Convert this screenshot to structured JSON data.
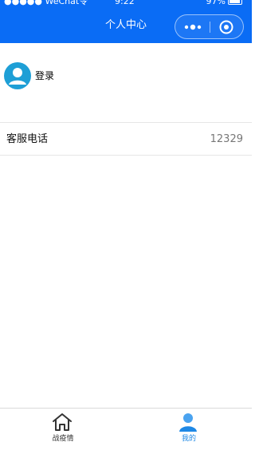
{
  "status_bar": {
    "carrier": "●●●●● WeChat令",
    "time": "9:22",
    "battery": "97%"
  },
  "header": {
    "title": "个人中心"
  },
  "user": {
    "login_label": "登录"
  },
  "service": {
    "label": "客服电话",
    "value": "12329"
  },
  "tabbar": {
    "tabs": [
      {
        "label": "战疫情",
        "icon": "home-icon",
        "active": false
      },
      {
        "label": "我的",
        "icon": "user-icon",
        "active": true
      }
    ]
  },
  "colors": {
    "header_bg": "#0a6cf5",
    "avatar": "#1e9fd6",
    "tab_active": "#1e88e5"
  }
}
